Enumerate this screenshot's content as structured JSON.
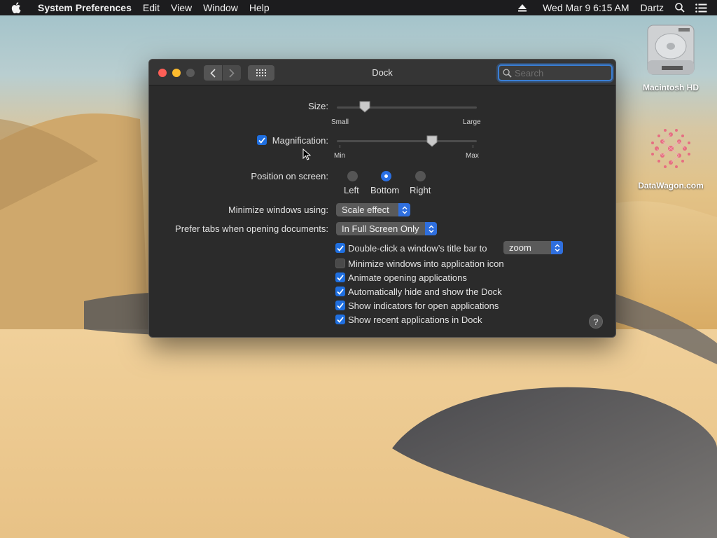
{
  "menubar": {
    "apple_icon": "apple-icon",
    "app_name": "System Preferences",
    "menus": [
      "Edit",
      "View",
      "Window",
      "Help"
    ],
    "clock": "Wed Mar 9  6:15 AM",
    "user": "Dartz"
  },
  "desktop": {
    "icons": [
      {
        "label": "Macintosh HD",
        "icon": "hard-drive-icon"
      },
      {
        "label": "DataWagon.com",
        "icon": "datawagon-logo-icon"
      }
    ]
  },
  "window": {
    "title": "Dock",
    "search_placeholder": "Search",
    "size": {
      "label": "Size:",
      "min_label": "Small",
      "max_label": "Large",
      "value": 0.2
    },
    "magnification": {
      "label": "Magnification:",
      "checked": true,
      "min_label": "Min",
      "max_label": "Max",
      "value": 0.68
    },
    "position": {
      "label": "Position on screen:",
      "options": [
        "Left",
        "Bottom",
        "Right"
      ],
      "selected": "Bottom"
    },
    "minimize_using": {
      "label": "Minimize windows using:",
      "value": "Scale effect"
    },
    "prefer_tabs": {
      "label": "Prefer tabs when opening documents:",
      "value": "In Full Screen Only"
    },
    "double_click": {
      "label": "Double-click a window’s title bar to",
      "checked": true,
      "value": "zoom"
    },
    "options": [
      {
        "label": "Minimize windows into application icon",
        "checked": false
      },
      {
        "label": "Animate opening applications",
        "checked": true
      },
      {
        "label": "Automatically hide and show the Dock",
        "checked": true
      },
      {
        "label": "Show indicators for open applications",
        "checked": true
      },
      {
        "label": "Show recent applications in Dock",
        "checked": true
      }
    ],
    "help_label": "?"
  },
  "colors": {
    "accent": "#2f6fde",
    "close": "#fe5f57",
    "minimize": "#febc2e",
    "zoom": "#5a5a5a"
  }
}
